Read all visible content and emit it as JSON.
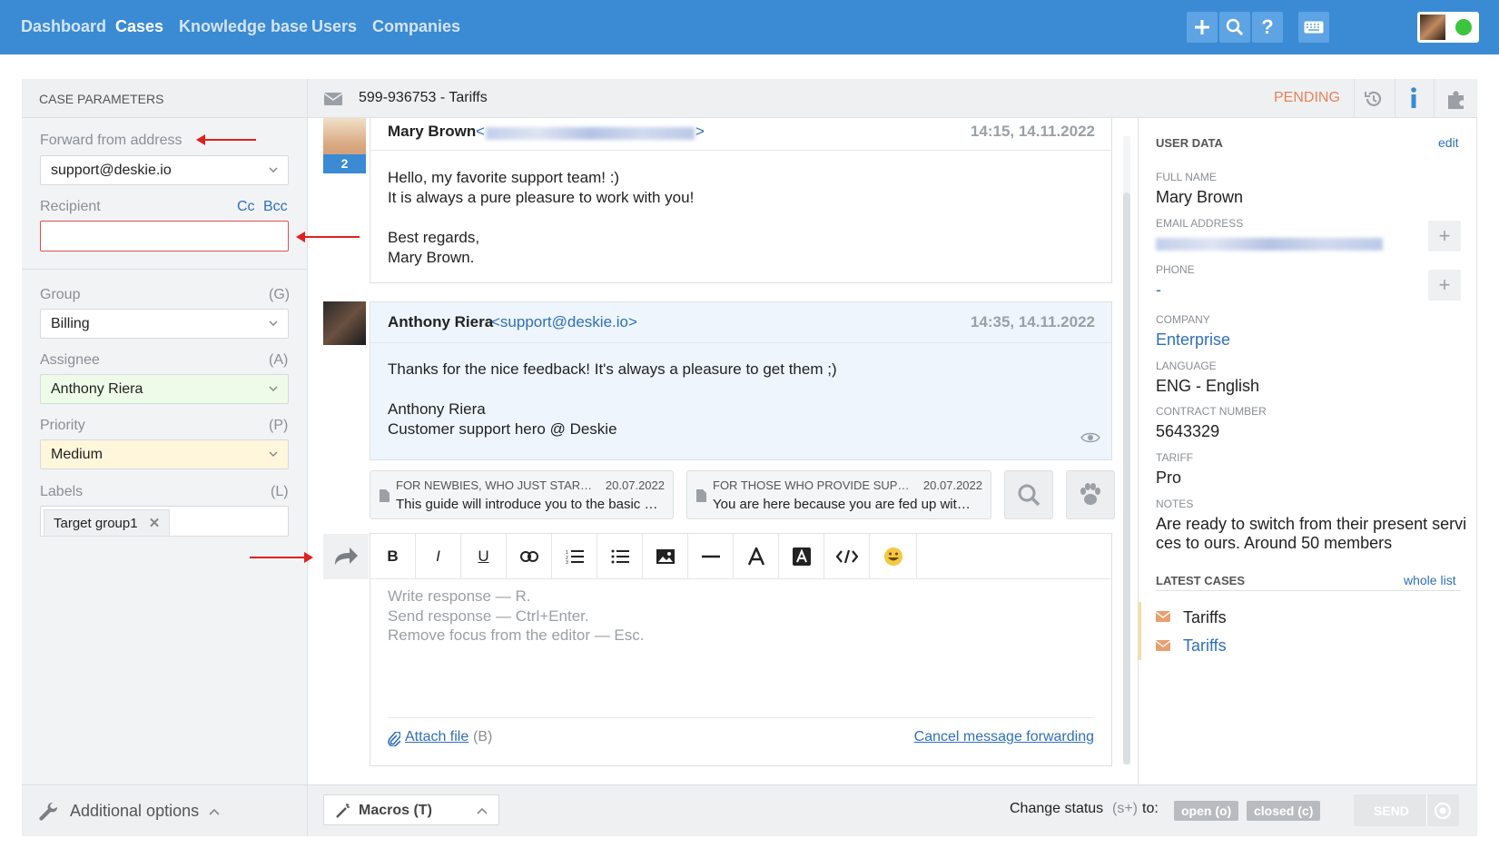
{
  "nav": {
    "items": [
      "Dashboard",
      "Cases",
      "Knowledge base",
      "Users",
      "Companies"
    ],
    "active": "Cases"
  },
  "top_icons": [
    "plus-icon",
    "search-icon",
    "help-icon",
    "keyboard-icon"
  ],
  "left": {
    "title": "CASE PARAMETERS",
    "forward_label": "Forward from address",
    "forward_value": "support@deskie.io",
    "recipient_label": "Recipient",
    "cc": "Cc",
    "bcc": "Bcc",
    "recipient_value": "",
    "group_label": "Group",
    "group_key": "(G)",
    "group_value": "Billing",
    "assignee_label": "Assignee",
    "assignee_key": "(A)",
    "assignee_value": "Anthony Riera",
    "priority_label": "Priority",
    "priority_key": "(P)",
    "priority_value": "Medium",
    "labels_label": "Labels",
    "labels_key": "(L)",
    "label_tag": "Target group1",
    "additional": "Additional options"
  },
  "header": {
    "case": "599-936753 - Tariffs",
    "status": "PENDING"
  },
  "messages": [
    {
      "name": "Mary Brown",
      "badge": "2",
      "time": "14:15, 14.11.2022",
      "lines": [
        "Hello, my favorite support team! :)",
        "It is always a pure pleasure to work with you!",
        "",
        "Best regards,",
        "Mary Brown."
      ]
    },
    {
      "name": "Anthony Riera",
      "email": "<support@deskie.io>",
      "time": "14:35, 14.11.2022",
      "lines": [
        "Thanks for the nice feedback! It's always a pleasure to get them ;)",
        "",
        "Anthony Riera",
        "Customer support hero @ Deskie"
      ]
    }
  ],
  "kb": [
    {
      "title": "FOR NEWBIES, WHO JUST STARTED",
      "date": "20.07.2022",
      "snippet": "This guide will introduce you to the basic features"
    },
    {
      "title": "FOR THOSE WHO PROVIDE SUPPORT",
      "date": "20.07.2022",
      "snippet": "You are here because you are fed up with your old"
    }
  ],
  "toolbar": [
    "B",
    "I",
    "U"
  ],
  "editor": {
    "placeholder": [
      "Write response — R.",
      "Send response — Ctrl+Enter.",
      "Remove focus from the editor — Esc."
    ],
    "attach": "Attach file",
    "attach_key": "(B)",
    "cancel": "Cancel message forwarding"
  },
  "user": {
    "section": "USER DATA",
    "edit": "edit",
    "full_name_label": "FULL NAME",
    "full_name": "Mary Brown",
    "email_label": "EMAIL ADDRESS",
    "phone_label": "PHONE",
    "phone": "-",
    "company_label": "COMPANY",
    "company": "Enterprise",
    "language_label": "LANGUAGE",
    "language": "ENG - English",
    "contract_label": "CONTRACT NUMBER",
    "contract": "5643329",
    "tariff_label": "TARIFF",
    "tariff": "Pro",
    "notes_label": "NOTES",
    "notes_1": "Are ready to switch from their present servi",
    "notes_2": "ces to ours. Around 50 members"
  },
  "latest": {
    "title": "LATEST CASES",
    "whole": "whole list",
    "items": [
      "Tariffs",
      "Tariffs"
    ]
  },
  "footer": {
    "macros": "Macros (T)",
    "change_status": "Change status",
    "shortcut": "(s+)",
    "to": "to:",
    "open": "open (o)",
    "closed": "closed (c)",
    "send": "SEND"
  },
  "colors": {
    "topbar": "#3a8bd3",
    "accent_link": "#2f6fbd",
    "pending": "#e8825a",
    "assignee_bg": "#eefbe8",
    "priority_bg": "#fff6dc",
    "error": "#e02020"
  }
}
